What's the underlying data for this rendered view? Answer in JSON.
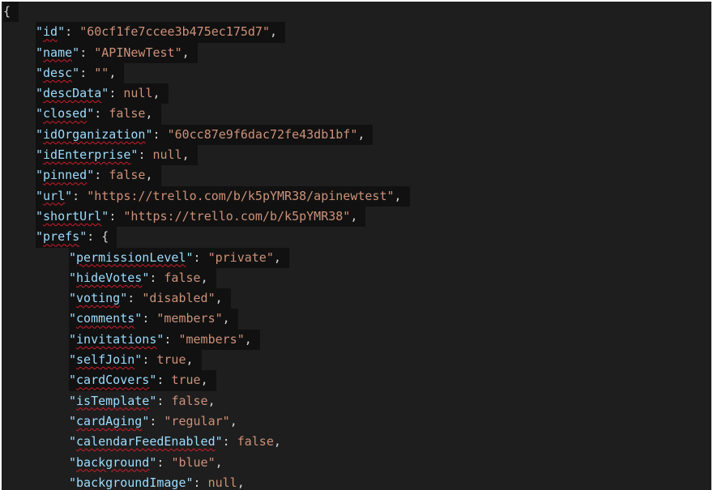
{
  "editor": {
    "open_brace": "{",
    "lines": [
      {
        "key": "id",
        "value": "\"60cf1fe7ccee3b475ec175d7\"",
        "kind": "str",
        "indent": 1
      },
      {
        "key": "name",
        "value": "\"APINewTest\"",
        "kind": "str",
        "indent": 1
      },
      {
        "key": "desc",
        "value": "\"\"",
        "kind": "str",
        "indent": 1
      },
      {
        "key": "descData",
        "value": "null",
        "kind": "lit",
        "indent": 1
      },
      {
        "key": "closed",
        "value": "false",
        "kind": "lit",
        "indent": 1
      },
      {
        "key": "idOrganization",
        "value": "\"60cc87e9f6dac72fe43db1bf\"",
        "kind": "str",
        "indent": 1
      },
      {
        "key": "idEnterprise",
        "value": "null",
        "kind": "lit",
        "indent": 1
      },
      {
        "key": "pinned",
        "value": "false",
        "kind": "lit",
        "indent": 1
      },
      {
        "key": "url",
        "value": "\"https://trello.com/b/k5pYMR38/apinewtest\"",
        "kind": "str",
        "indent": 1
      },
      {
        "key": "shortUrl",
        "value": "\"https://trello.com/b/k5pYMR38\"",
        "kind": "str",
        "indent": 1
      },
      {
        "key": "prefs",
        "value": "{",
        "kind": "brace",
        "indent": 1,
        "no_comma": true
      },
      {
        "key": "permissionLevel",
        "value": "\"private\"",
        "kind": "str",
        "indent": 2
      },
      {
        "key": "hideVotes",
        "value": "false",
        "kind": "lit",
        "indent": 2
      },
      {
        "key": "voting",
        "value": "\"disabled\"",
        "kind": "str",
        "indent": 2
      },
      {
        "key": "comments",
        "value": "\"members\"",
        "kind": "str",
        "indent": 2
      },
      {
        "key": "invitations",
        "value": "\"members\"",
        "kind": "str",
        "indent": 2
      },
      {
        "key": "selfJoin",
        "value": "true",
        "kind": "lit",
        "indent": 2
      },
      {
        "key": "cardCovers",
        "value": "true",
        "kind": "lit",
        "indent": 2
      },
      {
        "key": "isTemplate",
        "value": "false",
        "kind": "lit",
        "indent": 2
      },
      {
        "key": "cardAging",
        "value": "\"regular\"",
        "kind": "str",
        "indent": 2
      },
      {
        "key": "calendarFeedEnabled",
        "value": "false",
        "kind": "lit",
        "indent": 2
      },
      {
        "key": "background",
        "value": "\"blue\"",
        "kind": "str",
        "indent": 2
      },
      {
        "key": "backgroundImage",
        "value": "null",
        "kind": "lit",
        "indent": 2
      }
    ]
  },
  "colors": {
    "background": "#1e1e1e",
    "key": "#9cdcfe",
    "string": "#ce9178",
    "punctuation": "#d4d4d4",
    "squiggle": "#d11a2a"
  }
}
